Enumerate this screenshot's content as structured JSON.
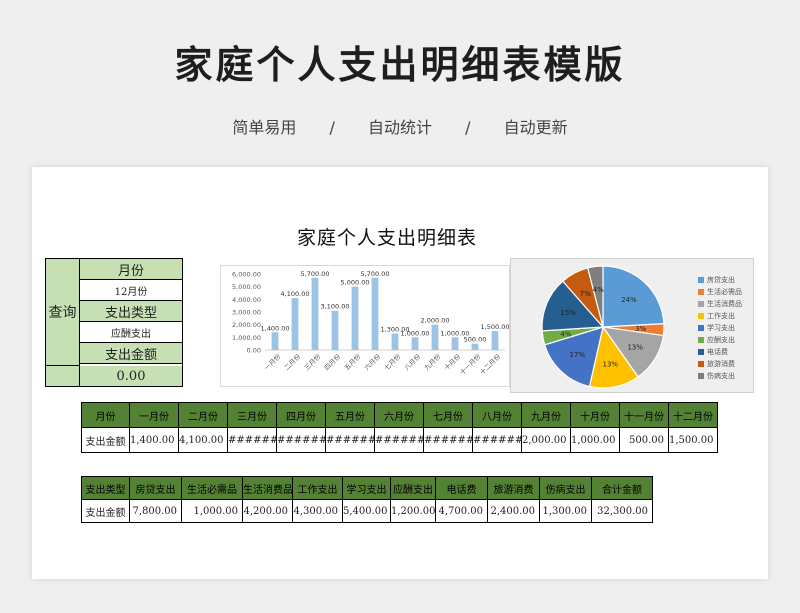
{
  "hero": {
    "title": "家庭个人支出明细表模版",
    "features": [
      "简单易用",
      "/",
      "自动统计",
      "/",
      "自动更新"
    ]
  },
  "doc_title": "家庭个人支出明细表",
  "query": {
    "label": "查询",
    "month_header": "月份",
    "month_value": "12月份",
    "type_header": "支出类型",
    "type_value": "应酬支出",
    "amount_header": "支出金额",
    "amount_value": "0.00"
  },
  "monthly_table": {
    "headers": [
      "月份",
      "一月份",
      "二月份",
      "三月份",
      "四月份",
      "五月份",
      "六月份",
      "七月份",
      "八月份",
      "九月份",
      "十月份",
      "十一月份",
      "十二月份"
    ],
    "row_label": "支出金额",
    "values": [
      "1,400.00",
      "4,100.00",
      "#########",
      "#########",
      "########",
      "#########",
      "#########",
      "########",
      "2,000.00",
      "1,000.00",
      "500.00",
      "1,500.00"
    ]
  },
  "category_table": {
    "headers": [
      "支出类型",
      "房贷支出",
      "生活必需品",
      "生活消费品",
      "工作支出",
      "学习支出",
      "应酬支出",
      "电话费",
      "旅游消费",
      "伤病支出",
      "合计金额"
    ],
    "row_label": "支出金额",
    "values": [
      "7,800.00",
      "1,000.00",
      "4,200.00",
      "4,300.00",
      "5,400.00",
      "1,200.00",
      "4,700.00",
      "2,400.00",
      "1,300.00",
      "32,300.00"
    ]
  },
  "chart_data": [
    {
      "type": "bar",
      "categories": [
        "一月份",
        "二月份",
        "三月份",
        "四月份",
        "五月份",
        "六月份",
        "七月份",
        "八月份",
        "九月份",
        "十月份",
        "十一月份",
        "十二月份"
      ],
      "values": [
        1400,
        4100,
        5700,
        3100,
        5000,
        5700,
        1300,
        1000,
        2000,
        1000,
        500,
        1500
      ],
      "data_labels": [
        "1,400.00",
        "4,100.00",
        "5,700.00",
        "3,100.00",
        "5,000.00",
        "5,700.00",
        "1,300.00",
        "1,000.00",
        "2,000.00",
        "1,000.00",
        "500.00",
        "1,500.00"
      ],
      "yticks": [
        "0.00",
        "1,000.00",
        "2,000.00",
        "3,000.00",
        "4,000.00",
        "5,000.00",
        "6,000.00"
      ],
      "ylim": [
        0,
        6000
      ],
      "color": "#9dc3e6",
      "grid": false
    },
    {
      "type": "pie",
      "labels": [
        "房贷支出",
        "生活必需品",
        "生活消费品",
        "工作支出",
        "学习支出",
        "应酬支出",
        "电话费",
        "旅游消费",
        "伤病支出"
      ],
      "values": [
        7800,
        1000,
        4200,
        4300,
        5400,
        1200,
        4700,
        2400,
        1300
      ],
      "percent_labels": [
        "24%",
        "3%",
        "13%",
        "13%",
        "17%",
        "4%",
        "15%",
        "7%",
        "4%"
      ],
      "colors": [
        "#5b9bd5",
        "#ed7d31",
        "#a5a5a5",
        "#ffc000",
        "#4472c4",
        "#70ad47",
        "#255e91",
        "#c55a11",
        "#7f7f7f"
      ],
      "legend_position": "right"
    }
  ]
}
